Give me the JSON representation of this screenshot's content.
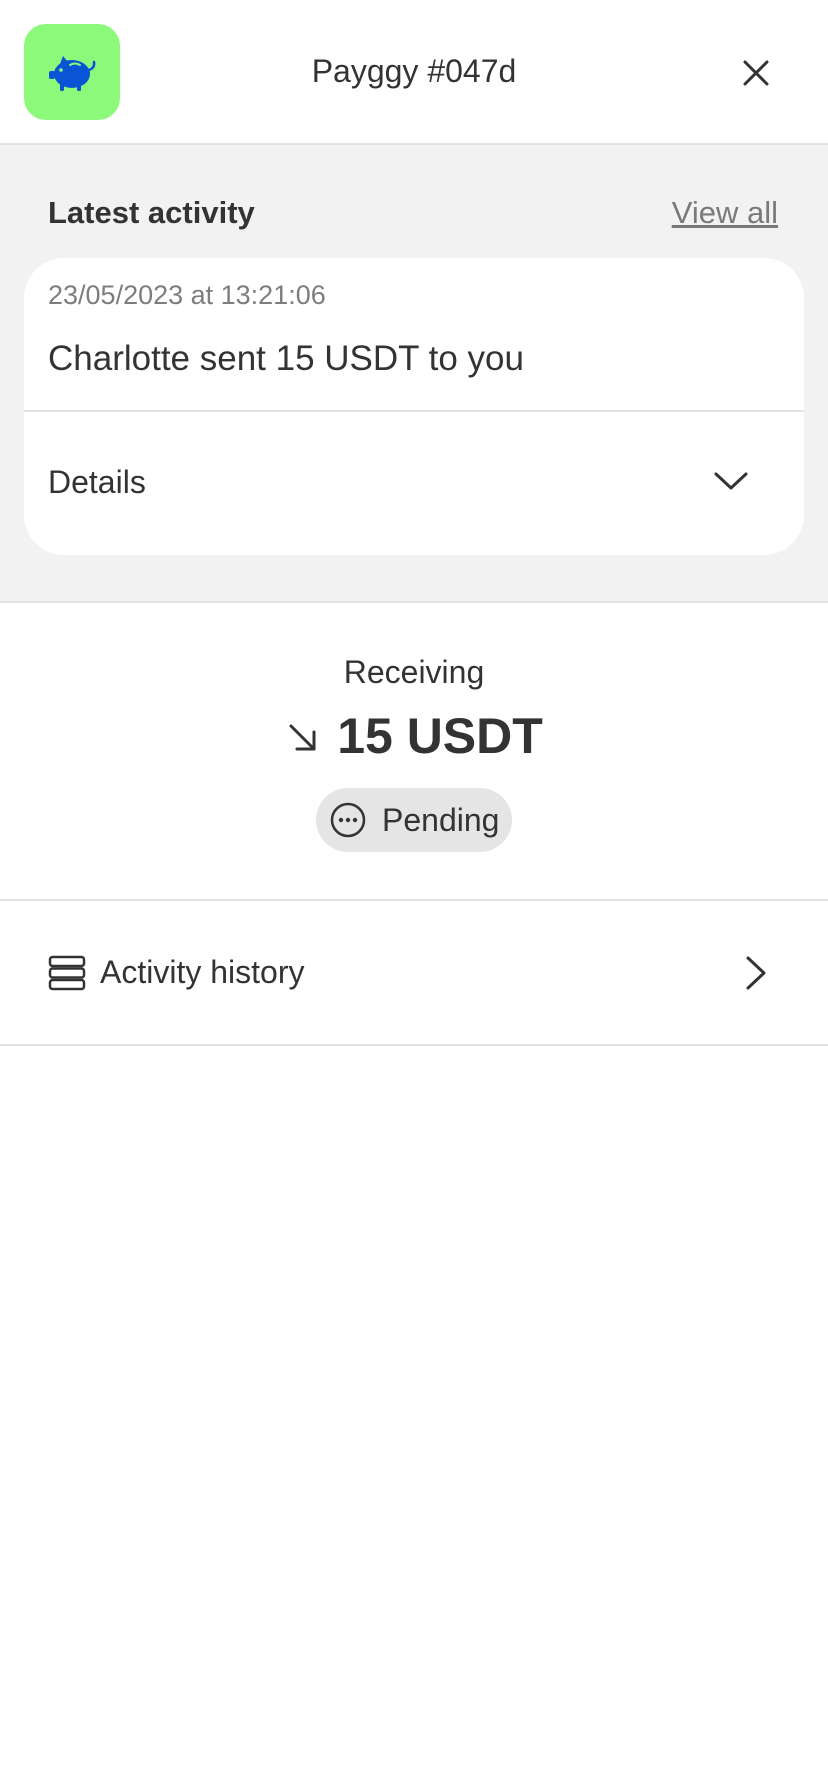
{
  "header": {
    "title": "Payggy #047d",
    "app_icon": "piggy-bank-icon",
    "app_icon_bg": "#8cf97a",
    "app_icon_color": "#0a55d6",
    "close_icon": "close-icon"
  },
  "latest_activity": {
    "title": "Latest activity",
    "view_all_label": "View all",
    "card": {
      "timestamp": "23/05/2023 at 13:21:06",
      "message": "Charlotte sent 15 USDT to you",
      "details_label": "Details",
      "details_icon": "chevron-down-icon"
    }
  },
  "summary": {
    "direction_label": "Receiving",
    "direction_icon": "arrow-down-right-icon",
    "amount": "15 USDT",
    "status_label": "Pending",
    "status_icon": "ellipsis-circle-icon",
    "status_bg": "#e5e5e5"
  },
  "activity_history": {
    "label": "Activity history",
    "icon": "list-stack-icon",
    "chevron_icon": "chevron-right-icon"
  },
  "colors": {
    "section_bg": "#f2f2f2",
    "divider": "#e3e3e3",
    "text": "#333333",
    "muted_text": "#7d7d7d"
  }
}
